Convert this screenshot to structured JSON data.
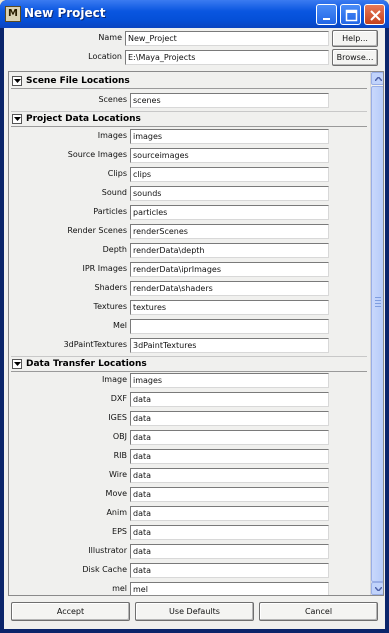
{
  "window": {
    "title": "New Project",
    "app_icon": "maya-icon",
    "controls": [
      "minimize-icon",
      "maximize-icon",
      "close-icon"
    ]
  },
  "header": {
    "name_label": "Name",
    "name_value": "New_Project",
    "location_label": "Location",
    "location_value": "E:\\Maya_Projects",
    "help_button": "Help...",
    "browse_button": "Browse..."
  },
  "sections": {
    "scene": {
      "title": "Scene File Locations",
      "rows": [
        {
          "label": "Scenes",
          "value": "scenes"
        }
      ]
    },
    "project": {
      "title": "Project Data Locations",
      "rows": [
        {
          "label": "Images",
          "value": "images"
        },
        {
          "label": "Source Images",
          "value": "sourceimages"
        },
        {
          "label": "Clips",
          "value": "clips"
        },
        {
          "label": "Sound",
          "value": "sounds"
        },
        {
          "label": "Particles",
          "value": "particles"
        },
        {
          "label": "Render Scenes",
          "value": "renderScenes"
        },
        {
          "label": "Depth",
          "value": "renderData\\depth"
        },
        {
          "label": "IPR Images",
          "value": "renderData\\iprImages"
        },
        {
          "label": "Shaders",
          "value": "renderData\\shaders"
        },
        {
          "label": "Textures",
          "value": "textures"
        },
        {
          "label": "Mel",
          "value": ""
        },
        {
          "label": "3dPaintTextures",
          "value": "3dPaintTextures"
        }
      ]
    },
    "transfer": {
      "title": "Data Transfer Locations",
      "rows": [
        {
          "label": "Image",
          "value": "images"
        },
        {
          "label": "DXF",
          "value": "data"
        },
        {
          "label": "IGES",
          "value": "data"
        },
        {
          "label": "OBJ",
          "value": "data"
        },
        {
          "label": "RIB",
          "value": "data"
        },
        {
          "label": "Wire",
          "value": "data"
        },
        {
          "label": "Move",
          "value": "data"
        },
        {
          "label": "Anim",
          "value": "data"
        },
        {
          "label": "EPS",
          "value": "data"
        },
        {
          "label": "Illustrator",
          "value": "data"
        },
        {
          "label": "Disk Cache",
          "value": "data"
        },
        {
          "label": "mel",
          "value": "mel"
        }
      ]
    }
  },
  "footer": {
    "accept": "Accept",
    "use_defaults": "Use Defaults",
    "cancel": "Cancel"
  },
  "colors": {
    "titlebar": "#0a56e0",
    "panel": "#f0f0ee",
    "field": "#ffffff"
  }
}
